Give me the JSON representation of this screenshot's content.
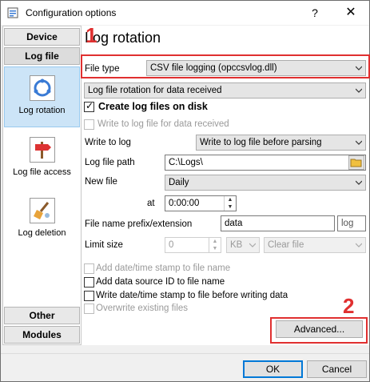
{
  "window": {
    "title": "Configuration options",
    "help_label": "?",
    "close_label": "✕"
  },
  "nav": {
    "top_buttons": [
      "Device",
      "Log file"
    ],
    "items": [
      {
        "label": "Log rotation",
        "icon": "log-rotation-icon"
      },
      {
        "label": "Log file access",
        "icon": "signpost-icon"
      },
      {
        "label": "Log deletion",
        "icon": "broom-icon"
      }
    ],
    "bottom_buttons": [
      "Other",
      "Modules"
    ]
  },
  "main": {
    "title": "Log rotation",
    "file_type_label": "File type",
    "file_type_value": "CSV file logging (opccsvlog.dll)",
    "rotation_value": "Log file rotation for data received",
    "create_log_files_label": "Create log files on disk",
    "write_to_log_file_label": "Write to log file for data received",
    "write_to_log_label": "Write to log",
    "write_to_log_value": "Write to log file before parsing",
    "log_file_path_label": "Log file path",
    "log_file_path_value": "C:\\Logs\\",
    "new_file_label": "New file",
    "new_file_value": "Daily",
    "at_label": "at",
    "at_value": "0:00:00",
    "prefix_label": "File name prefix/extension",
    "prefix_value": "data",
    "extension_value": "log",
    "limit_size_label": "Limit size",
    "limit_size_value": "0",
    "limit_unit_value": "KB",
    "limit_action_value": "Clear file",
    "opt_add_datetime_label": "Add date/time stamp to file name",
    "opt_add_datasource_label": "Add data source ID to file name",
    "opt_write_datetime_label": "Write date/time stamp to file before writing data",
    "opt_overwrite_label": "Overwrite existing files",
    "advanced_label": "Advanced..."
  },
  "annotations": {
    "marker_1": "1",
    "marker_2": "2",
    "color": "#e03030"
  },
  "footer": {
    "ok_label": "OK",
    "cancel_label": "Cancel"
  }
}
